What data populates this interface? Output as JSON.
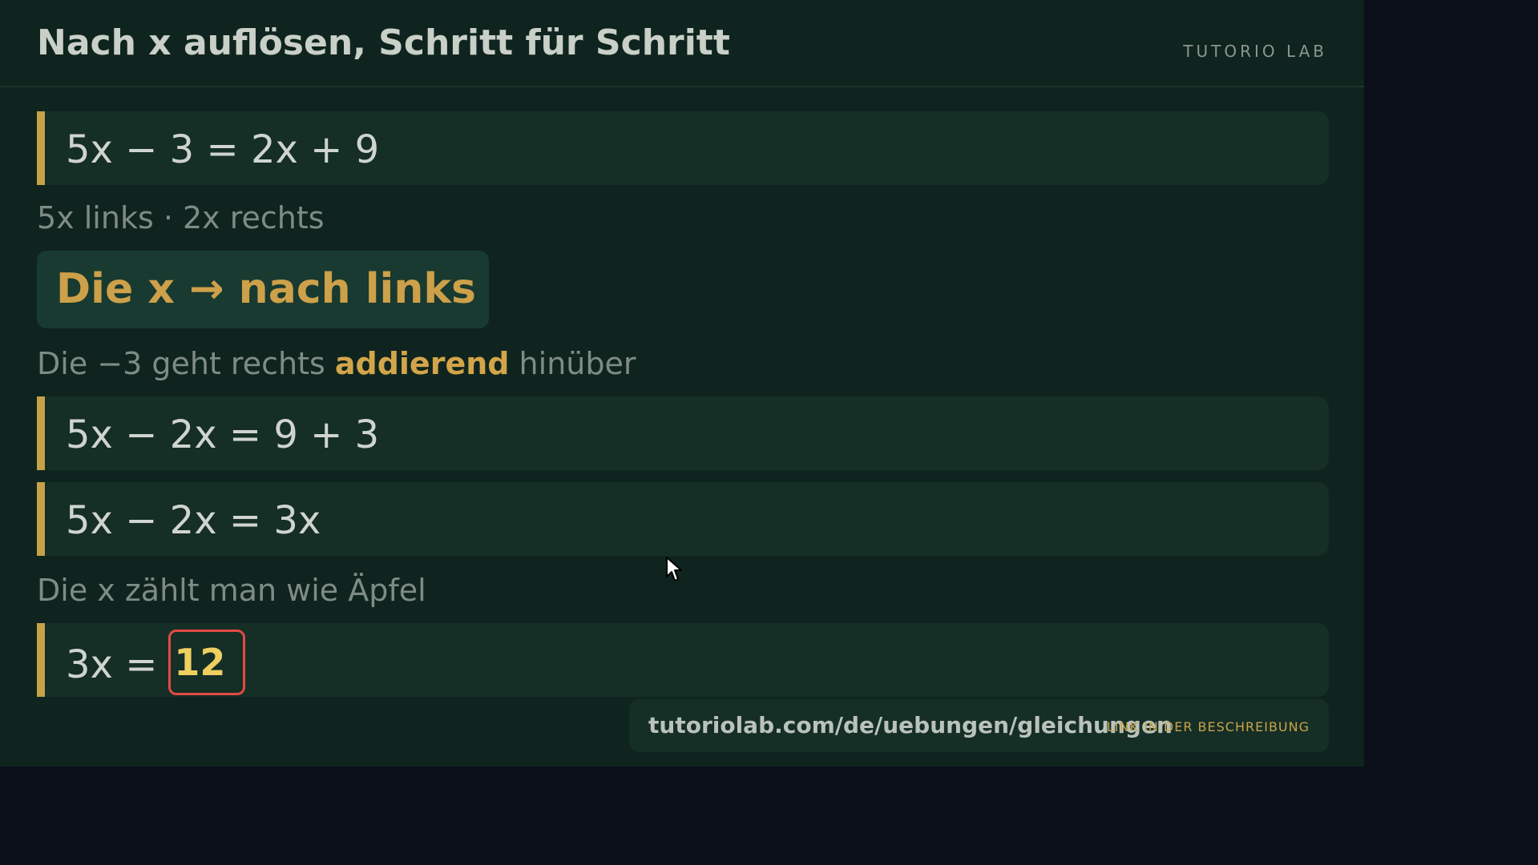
{
  "header": {
    "title": "Nach x auflösen, Schritt für Schritt",
    "brand": "TUTORIO LAB"
  },
  "steps": {
    "eq1": "5x − 3 = 2x + 9",
    "note1": "5x links  ·  2x rechts",
    "move": "Die x  →  nach links",
    "note2": {
      "before": "Die −3 geht rechts ",
      "highlight": "addierend",
      "after": " hinüber"
    },
    "eq2": "5x − 2x = 9 + 3",
    "eq3": "5x − 2x = 3x",
    "note3": "Die x zählt man wie Äpfel",
    "eq4_left": "3x =",
    "eq4_answer": "12"
  },
  "footer": {
    "url": "tutoriolab.com/de/uebungen/gleichungen",
    "cta": "LINK IN DER BESCHREIBUNG"
  },
  "colors": {
    "board": "#0f241e",
    "accent": "#c5a24a",
    "answer_border": "#e24a44",
    "answer_text": "#efcf5f"
  },
  "icons": {
    "cursor": "mouse-pointer-icon"
  }
}
